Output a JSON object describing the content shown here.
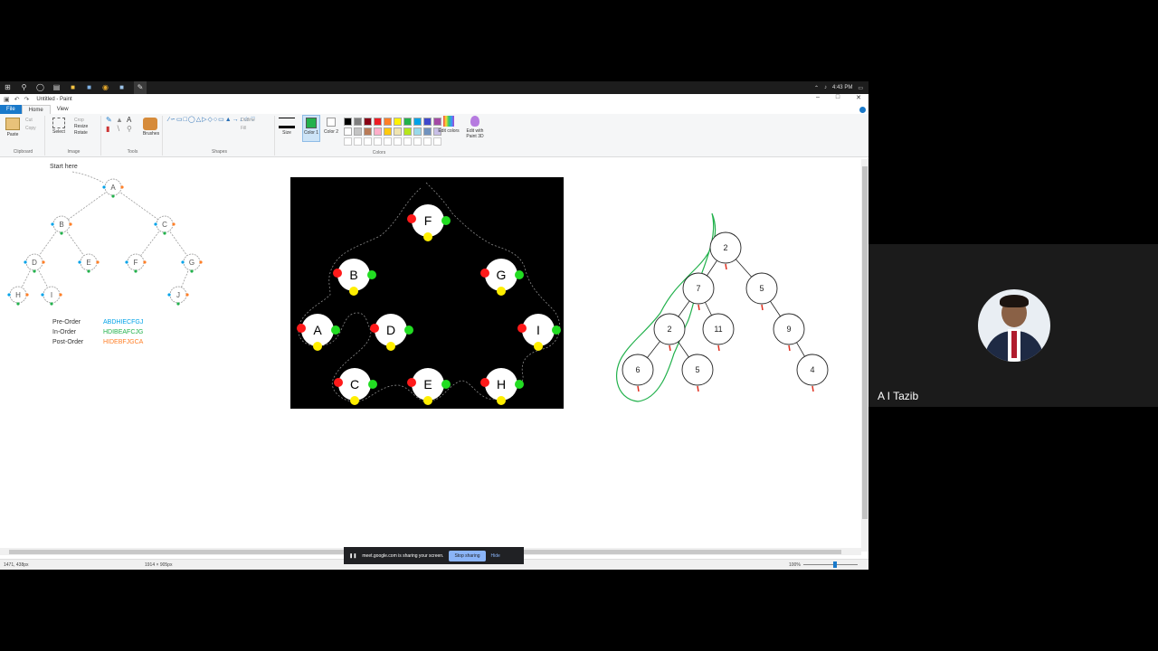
{
  "taskbar": {
    "icons": [
      "windows-icon",
      "search-icon",
      "cortana-icon",
      "task-view-icon",
      "file-explorer-icon",
      "app-icon",
      "chrome-icon",
      "app2-icon",
      "paint-icon"
    ],
    "time": "4:43 PM"
  },
  "window": {
    "title": "Untitled - Paint"
  },
  "tabs": [
    "File",
    "Home",
    "View"
  ],
  "ribbon": {
    "clipboard": {
      "label": "Clipboard",
      "paste": "Paste",
      "cut": "Cut",
      "copy": "Copy"
    },
    "image": {
      "label": "Image",
      "select": "Select",
      "crop": "Crop",
      "resize": "Resize",
      "rotate": "Rotate"
    },
    "tools": {
      "label": "Tools",
      "brushes": "Brushes"
    },
    "shapes": {
      "label": "Shapes",
      "outline": "Outline",
      "fill": "Fill"
    },
    "size": "Size",
    "color1": "Color 1",
    "color2": "Color 2",
    "colors_label": "Colors",
    "edit_colors": "Edit colors",
    "paint3d": "Edit with Paint 3D",
    "palette_row1": [
      "#000000",
      "#7f7f7f",
      "#880015",
      "#ed1c24",
      "#ff7f27",
      "#fff200",
      "#22b14c",
      "#00a2e8",
      "#3f48cc",
      "#a349a4"
    ],
    "palette_row2": [
      "#ffffff",
      "#c3c3c3",
      "#b97a57",
      "#ffaec9",
      "#ffc90e",
      "#efe4b0",
      "#b5e61d",
      "#99d9ea",
      "#7092be",
      "#c8bfe7"
    ],
    "color1_value": "#22b14c"
  },
  "canvas": {
    "tree1": {
      "start_label": "Start here",
      "nodes": [
        "A",
        "B",
        "C",
        "D",
        "E",
        "F",
        "G",
        "H",
        "I",
        "J"
      ],
      "orders": [
        {
          "name": "Pre-Order",
          "value": "ABDHIECFGJ",
          "color": "#00a2e8"
        },
        {
          "name": "In-Order",
          "value": "HDIBEAFCJG",
          "color": "#22b14c"
        },
        {
          "name": "Post-Order",
          "value": "HIDEBFJGCA",
          "color": "#ff7f27"
        }
      ]
    },
    "tree2": {
      "nodes": [
        "F",
        "B",
        "G",
        "A",
        "D",
        "I",
        "C",
        "E",
        "H"
      ]
    },
    "tree3": {
      "nodes": [
        "2",
        "7",
        "5",
        "2",
        "11",
        "9",
        "6",
        "5",
        "4"
      ]
    }
  },
  "status": {
    "cursor": "1471, 438px",
    "size": "1914 × 905px",
    "zoom": "100%"
  },
  "share_banner": {
    "text": "meet.google.com is sharing your screen.",
    "stop": "Stop sharing",
    "hide": "Hide"
  },
  "participant": {
    "name": "A I Tazib"
  }
}
